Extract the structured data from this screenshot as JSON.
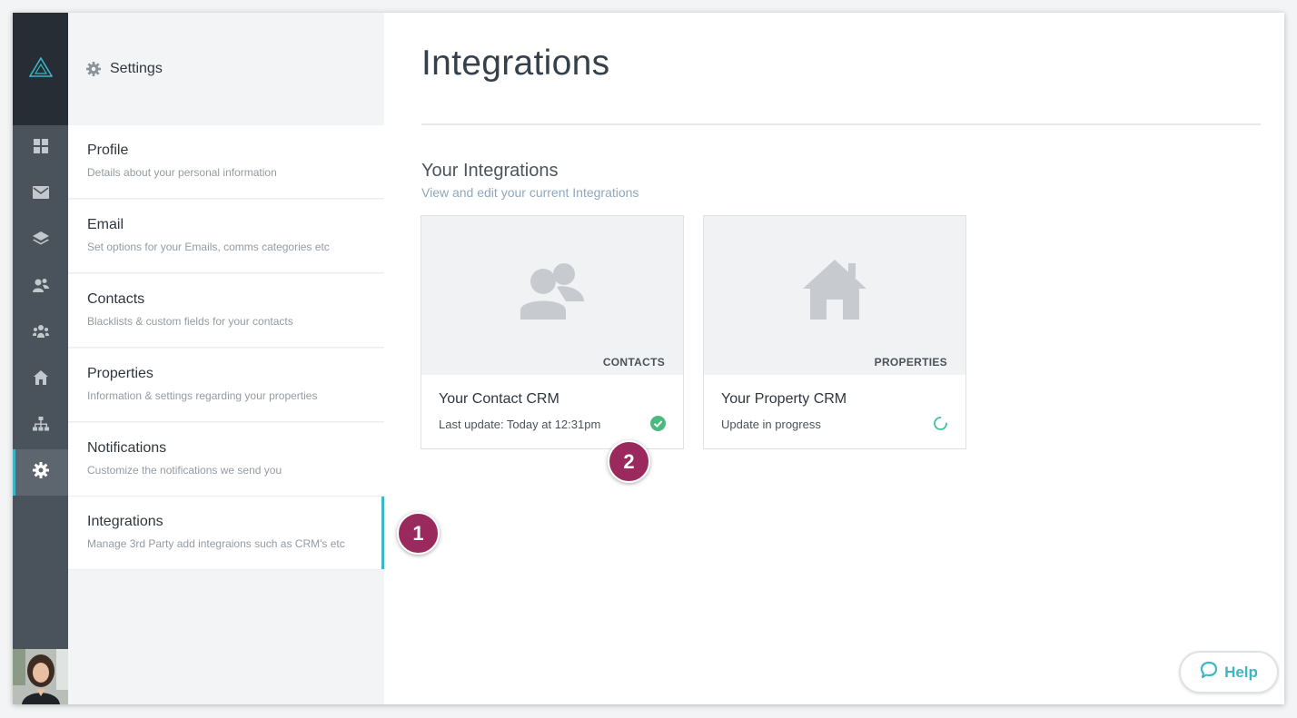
{
  "app": {
    "logo_icon": "triangle-logo-icon",
    "accent_color": "#3bb7c6",
    "badge_color": "#9a2a5e"
  },
  "rail": {
    "items": [
      {
        "icon": "dashboard-icon",
        "active": false
      },
      {
        "icon": "mail-icon",
        "active": false
      },
      {
        "icon": "layers-icon",
        "active": false
      },
      {
        "icon": "contacts-icon",
        "active": false
      },
      {
        "icon": "team-icon",
        "active": false
      },
      {
        "icon": "home-icon",
        "active": false
      },
      {
        "icon": "org-chart-icon",
        "active": false
      },
      {
        "icon": "gear-icon",
        "active": true
      }
    ],
    "avatar": "user-avatar"
  },
  "settings": {
    "title": "Settings",
    "items": [
      {
        "label": "Profile",
        "desc": "Details about your personal information"
      },
      {
        "label": "Email",
        "desc": "Set options for your Emails, comms categories etc"
      },
      {
        "label": "Contacts",
        "desc": "Blacklists & custom fields for your contacts"
      },
      {
        "label": "Properties",
        "desc": "Information & settings regarding your properties"
      },
      {
        "label": "Notifications",
        "desc": "Customize the notifications we send you"
      },
      {
        "label": "Integrations",
        "desc": "Manage 3rd Party add integraions such as CRM's etc"
      }
    ],
    "active_item": "Integrations"
  },
  "main": {
    "title": "Integrations",
    "section_title": "Your Integrations",
    "section_sub": "View and edit your current Integrations",
    "cards": [
      {
        "tag": "CONTACTS",
        "name": "Your Contact CRM",
        "status": "Last update: Today at 12:31pm",
        "state_icon": "check-circle-icon",
        "state_color": "#4cb97e"
      },
      {
        "tag": "PROPERTIES",
        "name": "Your Property CRM",
        "status": "Update in progress",
        "state_icon": "spinner-icon",
        "state_color": "#3cc0a0"
      }
    ]
  },
  "badges": [
    "1",
    "2"
  ],
  "help": {
    "label": "Help",
    "icon": "chat-bubble-icon"
  }
}
